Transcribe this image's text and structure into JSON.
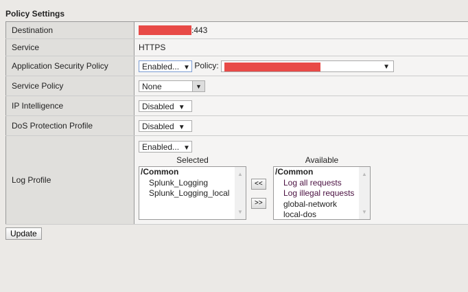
{
  "section_title": "Policy Settings",
  "rows": {
    "destination": {
      "label": "Destination",
      "port": ":443"
    },
    "service": {
      "label": "Service",
      "value": "HTTPS"
    },
    "asp": {
      "label": "Application Security Policy",
      "select": "Enabled...",
      "policy_label": "Policy:"
    },
    "service_policy": {
      "label": "Service Policy",
      "select": "None"
    },
    "ip": {
      "label": "IP Intelligence",
      "select": "Disabled"
    },
    "dos": {
      "label": "DoS Protection Profile",
      "select": "Disabled"
    },
    "log": {
      "label": "Log Profile",
      "select": "Enabled...",
      "selected_title": "Selected",
      "available_title": "Available",
      "selected": {
        "group": "/Common",
        "items": [
          "Splunk_Logging",
          "Splunk_Logging_local"
        ]
      },
      "available": {
        "group": "/Common",
        "items": [
          "Log all requests",
          "Log illegal requests",
          "global-network",
          "local-dos"
        ]
      },
      "add_label": "<<",
      "remove_label": ">>"
    }
  },
  "update_label": "Update",
  "redaction_color": "#e84a47"
}
